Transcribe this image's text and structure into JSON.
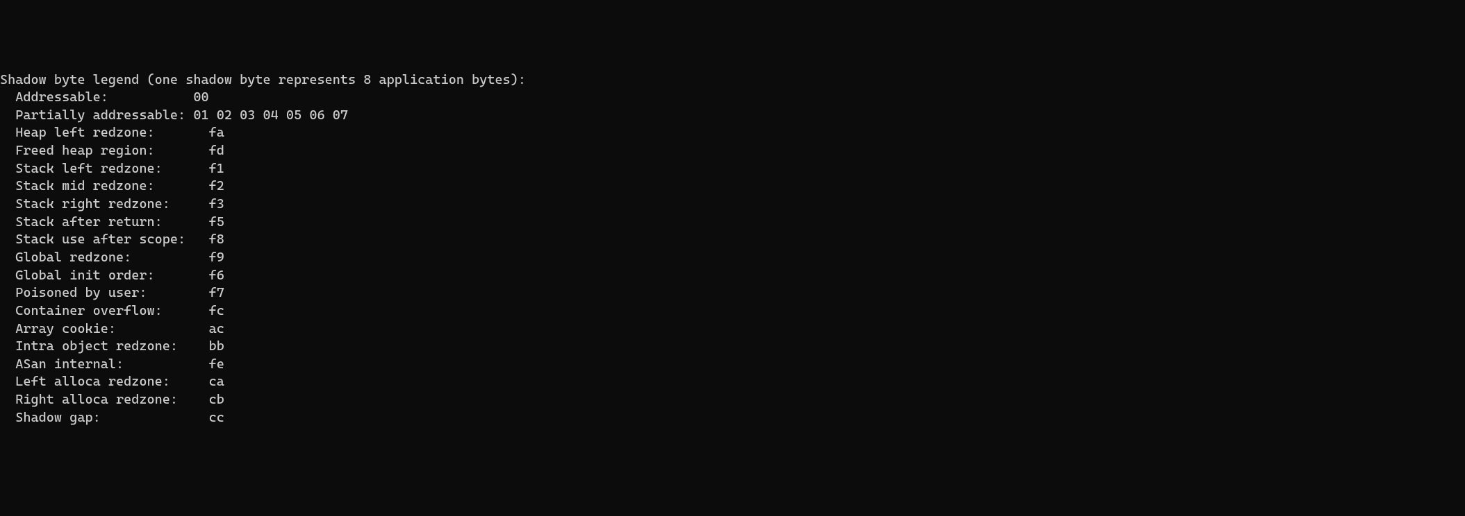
{
  "legend": {
    "title": "Shadow byte legend (one shadow byte represents 8 application bytes):",
    "lines": [
      "  Addressable:           00",
      "  Partially addressable: 01 02 03 04 05 06 07",
      "  Heap left redzone:       fa",
      "  Freed heap region:       fd",
      "  Stack left redzone:      f1",
      "  Stack mid redzone:       f2",
      "  Stack right redzone:     f3",
      "  Stack after return:      f5",
      "  Stack use after scope:   f8",
      "  Global redzone:          f9",
      "  Global init order:       f6",
      "  Poisoned by user:        f7",
      "  Container overflow:      fc",
      "  Array cookie:            ac",
      "  Intra object redzone:    bb",
      "  ASan internal:           fe",
      "  Left alloca redzone:     ca",
      "  Right alloca redzone:    cb",
      "  Shadow gap:              cc"
    ]
  }
}
